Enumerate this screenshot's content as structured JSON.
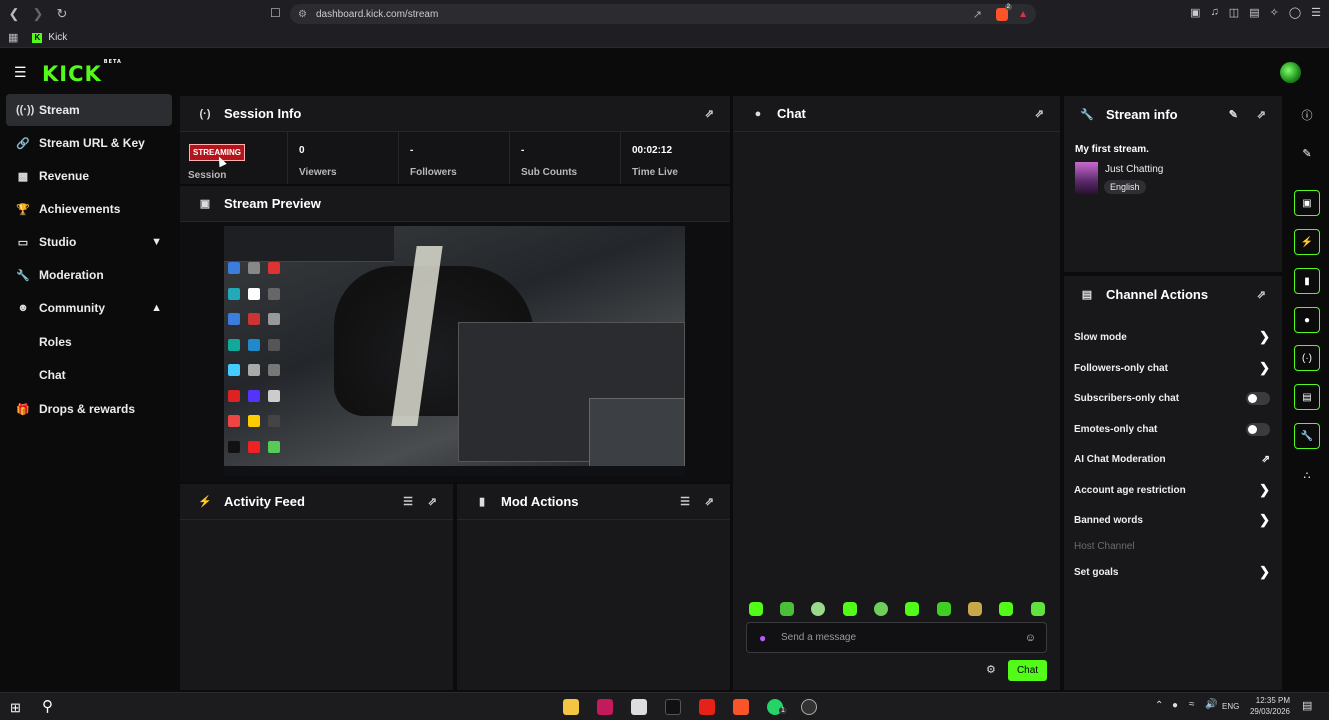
{
  "browser": {
    "url": "dashboard.kick.com/stream",
    "bookmark_label": "Kick",
    "brave_badge": "2"
  },
  "app": {
    "logo_text": "KICK",
    "logo_badge": "BETA"
  },
  "sidebar": {
    "items": [
      {
        "label": "Stream",
        "icon": "broadcast-icon",
        "active": true
      },
      {
        "label": "Stream URL & Key",
        "icon": "link-icon"
      },
      {
        "label": "Revenue",
        "icon": "chart-icon"
      },
      {
        "label": "Achievements",
        "icon": "trophy-icon"
      },
      {
        "label": "Studio",
        "icon": "studio-icon",
        "chevron": "down"
      },
      {
        "label": "Moderation",
        "icon": "wrench-icon"
      },
      {
        "label": "Community",
        "icon": "people-icon",
        "chevron": "up"
      },
      {
        "label": "Roles",
        "sub": true
      },
      {
        "label": "Chat",
        "sub": true
      },
      {
        "label": "Drops & rewards",
        "icon": "gift-icon"
      }
    ]
  },
  "session": {
    "title": "Session Info",
    "badge": "STREAMING",
    "session_label": "Session",
    "viewers_value": "0",
    "viewers_label": "Viewers",
    "followers_value": "-",
    "followers_label": "Followers",
    "subs_value": "-",
    "subs_label": "Sub Counts",
    "time_value": "00:02:12",
    "time_label": "Time Live"
  },
  "preview": {
    "title": "Stream Preview"
  },
  "activity": {
    "title": "Activity Feed"
  },
  "mod": {
    "title": "Mod Actions"
  },
  "chat": {
    "title": "Chat",
    "placeholder": "Send a message",
    "send_label": "Chat"
  },
  "stream_info": {
    "title": "Stream info",
    "stream_title": "My first stream.",
    "category": "Just Chatting",
    "language": "English"
  },
  "channel_actions": {
    "title": "Channel Actions",
    "rows": [
      {
        "label": "Slow mode",
        "control": "chevron"
      },
      {
        "label": "Followers-only chat",
        "control": "chevron"
      },
      {
        "label": "Subscribers-only chat",
        "control": "toggle-off"
      },
      {
        "label": "Emotes-only chat",
        "control": "toggle-off"
      },
      {
        "label": "AI Chat Moderation",
        "control": "external-link"
      },
      {
        "label": "Account age restriction",
        "control": "chevron"
      },
      {
        "label": "Banned words",
        "control": "chevron"
      },
      {
        "label": "Host Channel",
        "control": "disabled"
      },
      {
        "label": "Set goals",
        "control": "chevron"
      }
    ]
  },
  "taskbar": {
    "lang": "ENG",
    "time": "12:35 PM",
    "date": "29/03/2026",
    "whatsapp_badge": "1"
  },
  "colors": {
    "accent": "#53fc18",
    "panel": "#18181b",
    "background": "#0b0b0c",
    "streaming_red": "#b3151d"
  }
}
